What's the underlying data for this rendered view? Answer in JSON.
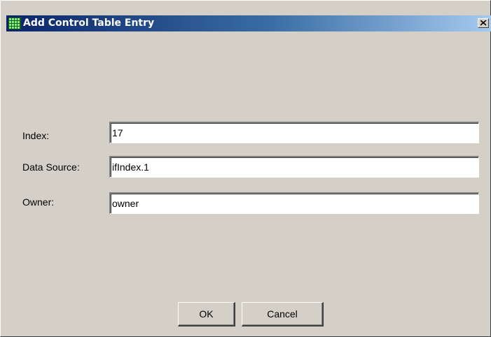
{
  "window": {
    "title": "Add Control Table Entry",
    "title_icon": "grid-icon",
    "close_icon": "close-icon",
    "colors": {
      "titlebar_start": "#0a246a",
      "titlebar_end": "#a6caf0",
      "face": "#d4d0c8"
    }
  },
  "form": {
    "index_label": "Index:",
    "index_value": "17",
    "data_source_label": "Data Source:",
    "data_source_value": "ifIndex.1",
    "owner_label": "Owner:",
    "owner_value": "owner"
  },
  "buttons": {
    "ok_label": "OK",
    "cancel_label": "Cancel"
  }
}
